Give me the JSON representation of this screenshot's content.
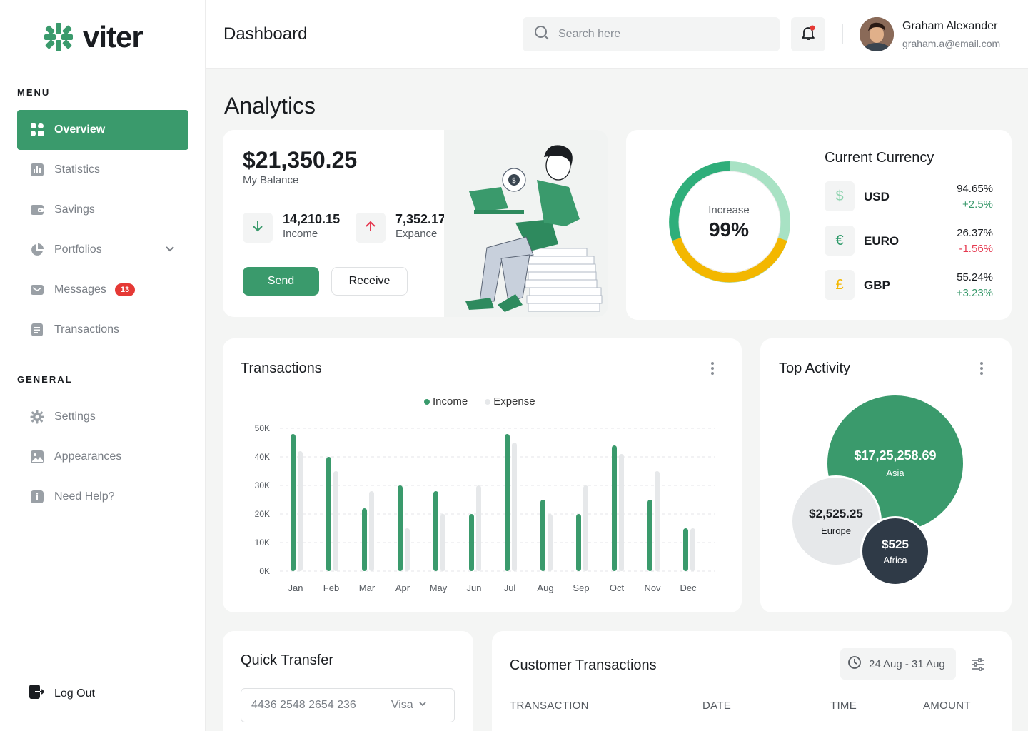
{
  "app": {
    "name": "viter"
  },
  "sidebar": {
    "menu_label": "MENU",
    "general_label": "GENERAL",
    "menu_items": [
      {
        "label": "Overview",
        "icon": "grid-icon",
        "active": true
      },
      {
        "label": "Statistics",
        "icon": "bar-chart-icon"
      },
      {
        "label": "Savings",
        "icon": "wallet-icon"
      },
      {
        "label": "Portfolios",
        "icon": "pie-chart-icon",
        "has_chevron": true
      },
      {
        "label": "Messages",
        "icon": "mail-icon",
        "badge": "13"
      },
      {
        "label": "Transactions",
        "icon": "document-icon"
      }
    ],
    "general_items": [
      {
        "label": "Settings",
        "icon": "gear-icon"
      },
      {
        "label": "Appearances",
        "icon": "image-icon"
      },
      {
        "label": "Need Help?",
        "icon": "info-icon"
      }
    ],
    "logout": "Log Out"
  },
  "header": {
    "title": "Dashboard",
    "search_placeholder": "Search here",
    "user_name": "Graham Alexander",
    "user_email": "graham.a@email.com"
  },
  "page_title": "Analytics",
  "balance": {
    "amount": "$21,350.25",
    "label": "My Balance",
    "income_value": "14,210.15",
    "income_label": "Income",
    "expense_value": "7,352.17",
    "expense_label": "Expance",
    "send_label": "Send",
    "receive_label": "Receive"
  },
  "currency": {
    "donut_label": "Increase",
    "donut_value": "99%",
    "title": "Current Currency",
    "items": [
      {
        "symbol": "$",
        "name": "USD",
        "pct": "94.65%",
        "change": "+2.5%",
        "positive": true,
        "color": "#8fd4b0"
      },
      {
        "symbol": "€",
        "name": "EURO",
        "pct": "26.37%",
        "change": "-1.56%",
        "positive": false,
        "color": "#2e9a6a"
      },
      {
        "symbol": "£",
        "name": "GBP",
        "pct": "55.24%",
        "change": "+3.23%",
        "positive": true,
        "color": "#f3b700"
      }
    ]
  },
  "transactions_chart": {
    "title": "Transactions",
    "chart_data": {
      "type": "bar",
      "categories": [
        "Jan",
        "Feb",
        "Mar",
        "Apr",
        "May",
        "Jun",
        "Jul",
        "Aug",
        "Sep",
        "Oct",
        "Nov",
        "Dec"
      ],
      "series": [
        {
          "name": "Income",
          "color": "#3a9a6c",
          "values": [
            48000,
            40000,
            22000,
            30000,
            28000,
            20000,
            48000,
            25000,
            20000,
            44000,
            25000,
            15000
          ]
        },
        {
          "name": "Expense",
          "color": "#e6e8ea",
          "values": [
            42000,
            35000,
            28000,
            15000,
            20000,
            30000,
            45000,
            20000,
            30000,
            41000,
            35000,
            15000
          ]
        }
      ],
      "yticks": [
        "0K",
        "10K",
        "20K",
        "30K",
        "40K",
        "50K"
      ],
      "ylim": [
        0,
        50000
      ]
    }
  },
  "top_activity": {
    "title": "Top Activity",
    "bubbles": [
      {
        "amount": "$17,25,258.69",
        "region": "Asia"
      },
      {
        "amount": "$2,525.25",
        "region": "Europe"
      },
      {
        "amount": "$525",
        "region": "Africa"
      }
    ]
  },
  "quick_transfer": {
    "title": "Quick Transfer",
    "card_number": "4436  2548  2654  236",
    "card_type": "Visa"
  },
  "customer_transactions": {
    "title": "Customer Transactions",
    "date_range": "24 Aug - 31 Aug",
    "columns": [
      "TRANSACTION",
      "DATE",
      "TIME",
      "AMOUNT"
    ]
  },
  "colors": {
    "accent": "#3a9a6c",
    "negative": "#e53950",
    "donut_yellow": "#f3b700",
    "donut_light": "#a8e2c4"
  }
}
